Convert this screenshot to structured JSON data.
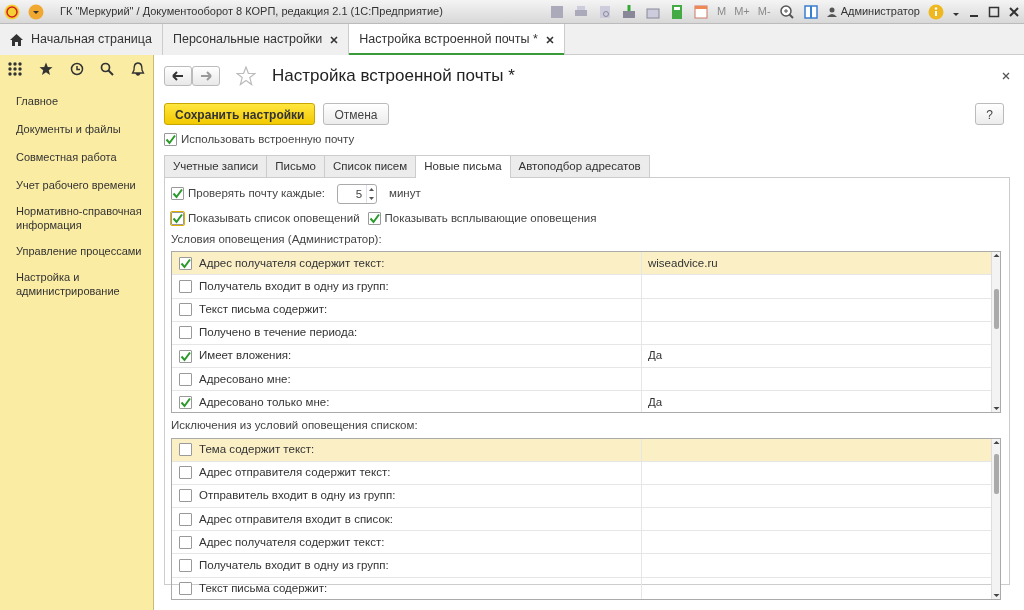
{
  "window": {
    "title": "ГК \"Меркурий\" / Документооборот 8 КОРП, редакция 2.1  (1С:Предприятие)",
    "memory_keys": [
      "M",
      "M+",
      "M-"
    ],
    "user": "Администратор"
  },
  "tabs": [
    {
      "label": "Начальная страница",
      "selected": false,
      "closable": false
    },
    {
      "label": "Персональные настройки",
      "selected": false,
      "closable": true
    },
    {
      "label": "Настройка встроенной почты *",
      "selected": true,
      "closable": true
    }
  ],
  "sidebar": {
    "items": [
      "Главное",
      "Документы и файлы",
      "Совместная работа",
      "Учет рабочего времени",
      "Нормативно-справочная информация",
      "Управление процессами",
      "Настройка и администрирование"
    ]
  },
  "form": {
    "title": "Настройка встроенной почты *",
    "save_button": "Сохранить настройки",
    "cancel_button": "Отмена",
    "help_button": "?",
    "use_mail": {
      "label": "Использовать встроенную почту",
      "checked": true
    },
    "tabs": [
      {
        "label": "Учетные записи",
        "selected": false
      },
      {
        "label": "Письмо",
        "selected": false
      },
      {
        "label": "Список писем",
        "selected": false
      },
      {
        "label": "Новые письма",
        "selected": true
      },
      {
        "label": "Автоподбор адресатов",
        "selected": false
      }
    ],
    "check_interval": {
      "label": "Проверять почту каждые:",
      "checked": true,
      "value": "5",
      "unit": "минут"
    },
    "show_list": {
      "label": "Показывать список оповещений",
      "checked": true
    },
    "show_popups": {
      "label": "Показывать всплывающие оповещения",
      "checked": true
    },
    "conditions": {
      "label": "Условия оповещения (Администратор):",
      "rows": [
        {
          "label": "Адрес получателя содержит текст:",
          "checked": true,
          "value": "wiseadvice.ru",
          "selected": true
        },
        {
          "label": "Получатель входит в одну из групп:",
          "checked": false,
          "selected": false
        },
        {
          "label": "Текст письма содержит:",
          "checked": false,
          "selected": false
        },
        {
          "label": "Получено в течение периода:",
          "checked": false,
          "selected": false
        },
        {
          "label": "Имеет вложения:",
          "checked": true,
          "value": "Да",
          "selected": false
        },
        {
          "label": "Адресовано мне:",
          "checked": false,
          "selected": false
        },
        {
          "label": "Адресовано только мне:",
          "checked": true,
          "value": "Да",
          "selected": false
        }
      ]
    },
    "exceptions": {
      "label": "Исключения из условий оповещения списком:",
      "rows": [
        {
          "label": "Тема содержит текст:",
          "checked": false,
          "selected": true
        },
        {
          "label": "Адрес отправителя содержит текст:",
          "checked": false,
          "selected": false
        },
        {
          "label": "Отправитель входит в одну из групп:",
          "checked": false,
          "selected": false
        },
        {
          "label": "Адрес отправителя входит в список:",
          "checked": false,
          "selected": false
        },
        {
          "label": "Адрес получателя содержит текст:",
          "checked": false,
          "selected": false
        },
        {
          "label": "Получатель входит в одну из групп:",
          "checked": false,
          "selected": false
        },
        {
          "label": "Текст письма содержит:",
          "checked": false,
          "selected": false
        }
      ]
    }
  }
}
